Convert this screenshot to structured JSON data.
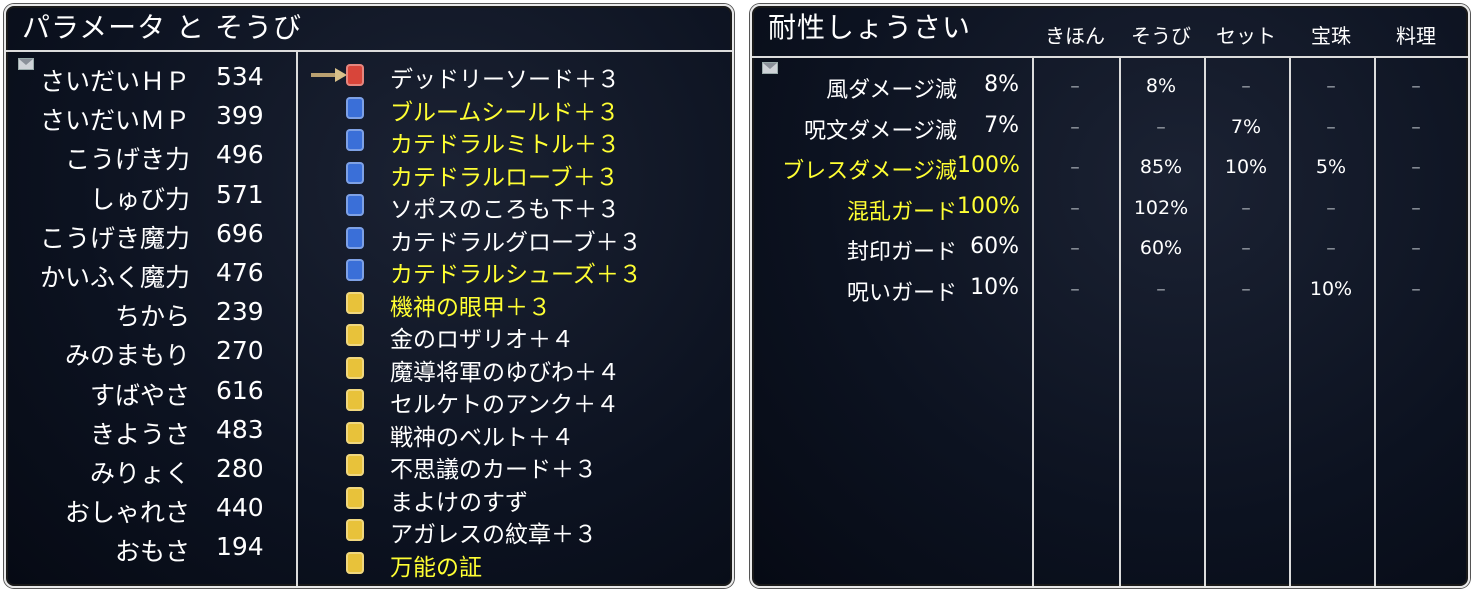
{
  "left": {
    "title": "パラメータ と そうび",
    "stats": [
      {
        "name": "さいだいＨＰ",
        "value": "534"
      },
      {
        "name": "さいだいＭＰ",
        "value": "399"
      },
      {
        "name": "こうげき力",
        "value": "496"
      },
      {
        "name": "しゅび力",
        "value": "571"
      },
      {
        "name": "こうげき魔力",
        "value": "696"
      },
      {
        "name": "かいふく魔力",
        "value": "476"
      },
      {
        "name": "ちから",
        "value": "239"
      },
      {
        "name": "みのまもり",
        "value": "270"
      },
      {
        "name": "すばやさ",
        "value": "616"
      },
      {
        "name": "きようさ",
        "value": "483"
      },
      {
        "name": "みりょく",
        "value": "280"
      },
      {
        "name": "おしゃれさ",
        "value": "440"
      },
      {
        "name": "おもさ",
        "value": "194"
      }
    ],
    "equipment": [
      {
        "name": "デッドリーソード＋３",
        "highlight": false,
        "icon": "sword-icon",
        "color": "#d8453a"
      },
      {
        "name": "ブルームシールド＋３",
        "highlight": true,
        "icon": "shield-icon",
        "color": "#3a6fd8"
      },
      {
        "name": "カテドラルミトル＋３",
        "highlight": true,
        "icon": "head-icon",
        "color": "#3a6fd8"
      },
      {
        "name": "カテドラルローブ＋３",
        "highlight": true,
        "icon": "body-upper-icon",
        "color": "#3a6fd8"
      },
      {
        "name": "ソポスのころも下＋３",
        "highlight": false,
        "icon": "body-lower-icon",
        "color": "#3a6fd8"
      },
      {
        "name": "カテドラルグローブ＋３",
        "highlight": false,
        "icon": "arm-icon",
        "color": "#3a6fd8"
      },
      {
        "name": "カテドラルシューズ＋３",
        "highlight": true,
        "icon": "foot-icon",
        "color": "#3a6fd8"
      },
      {
        "name": "機神の眼甲＋３",
        "highlight": true,
        "icon": "face-accessory-icon",
        "color": "#e8c23a"
      },
      {
        "name": "金のロザリオ＋４",
        "highlight": false,
        "icon": "neck-accessory-icon",
        "color": "#e8c23a"
      },
      {
        "name": "魔導将軍のゆびわ＋４",
        "highlight": false,
        "icon": "finger-accessory-icon",
        "color": "#e8c23a"
      },
      {
        "name": "セルケトのアンク＋４",
        "highlight": false,
        "icon": "chest-accessory-icon",
        "color": "#e8c23a"
      },
      {
        "name": "戦神のベルト＋４",
        "highlight": false,
        "icon": "waist-accessory-icon",
        "color": "#e8c23a"
      },
      {
        "name": "不思議のカード＋３",
        "highlight": false,
        "icon": "card-accessory-icon",
        "color": "#e8c23a"
      },
      {
        "name": "まよけのすず",
        "highlight": false,
        "icon": "other-accessory-icon",
        "color": "#e8c23a"
      },
      {
        "name": "アガレスの紋章＋３",
        "highlight": false,
        "icon": "crest-accessory-icon",
        "color": "#e8c23a"
      },
      {
        "name": "万能の証",
        "highlight": true,
        "icon": "proof-accessory-icon",
        "color": "#e8c23a"
      }
    ]
  },
  "right": {
    "title": "耐性しょうさい",
    "columns": [
      "きほん",
      "そうび",
      "セット",
      "宝珠",
      "料理"
    ],
    "rows": [
      {
        "name": "風ダメージ減",
        "total": "8%",
        "highlight": false,
        "cells": [
          "–",
          "8%",
          "–",
          "–",
          "–"
        ]
      },
      {
        "name": "呪文ダメージ減",
        "total": "7%",
        "highlight": false,
        "cells": [
          "–",
          "–",
          "7%",
          "–",
          "–"
        ]
      },
      {
        "name": "ブレスダメージ減",
        "total": "100%",
        "highlight": true,
        "cells": [
          "–",
          "85%",
          "10%",
          "5%",
          "–"
        ]
      },
      {
        "name": "混乱ガード",
        "total": "100%",
        "highlight": true,
        "cells": [
          "–",
          "102%",
          "–",
          "–",
          "–"
        ]
      },
      {
        "name": "封印ガード",
        "total": "60%",
        "highlight": false,
        "cells": [
          "–",
          "60%",
          "–",
          "–",
          "–"
        ]
      },
      {
        "name": "呪いガード",
        "total": "10%",
        "highlight": false,
        "cells": [
          "–",
          "–",
          "–",
          "10%",
          "–"
        ]
      }
    ]
  },
  "colors": {
    "highlight": "#ffff33",
    "panel_bg": "#0c1220",
    "frame": "#e9e9e9"
  }
}
